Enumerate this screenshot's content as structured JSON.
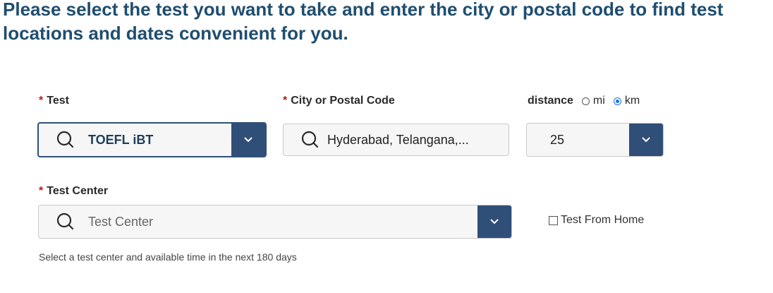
{
  "heading": "Please select the test you want to take and enter the city or postal code to find test locations and dates convenient for you.",
  "required_marker": "*",
  "test": {
    "label": "Test",
    "value": "TOEFL iBT"
  },
  "city": {
    "label": "City or Postal Code",
    "value": "Hyderabad, Telangana,..."
  },
  "distance": {
    "label": "distance",
    "options": [
      {
        "label": "mi",
        "checked": false
      },
      {
        "label": "km",
        "checked": true
      }
    ],
    "value": "25"
  },
  "test_center": {
    "label": "Test Center",
    "placeholder": "Test Center"
  },
  "test_from_home": {
    "label": "Test From Home",
    "checked": false
  },
  "hint": "Select a test center and available time in the next 180 days",
  "colors": {
    "heading": "#1f4e6f",
    "accent": "#2f4f78",
    "required": "#b32020"
  }
}
